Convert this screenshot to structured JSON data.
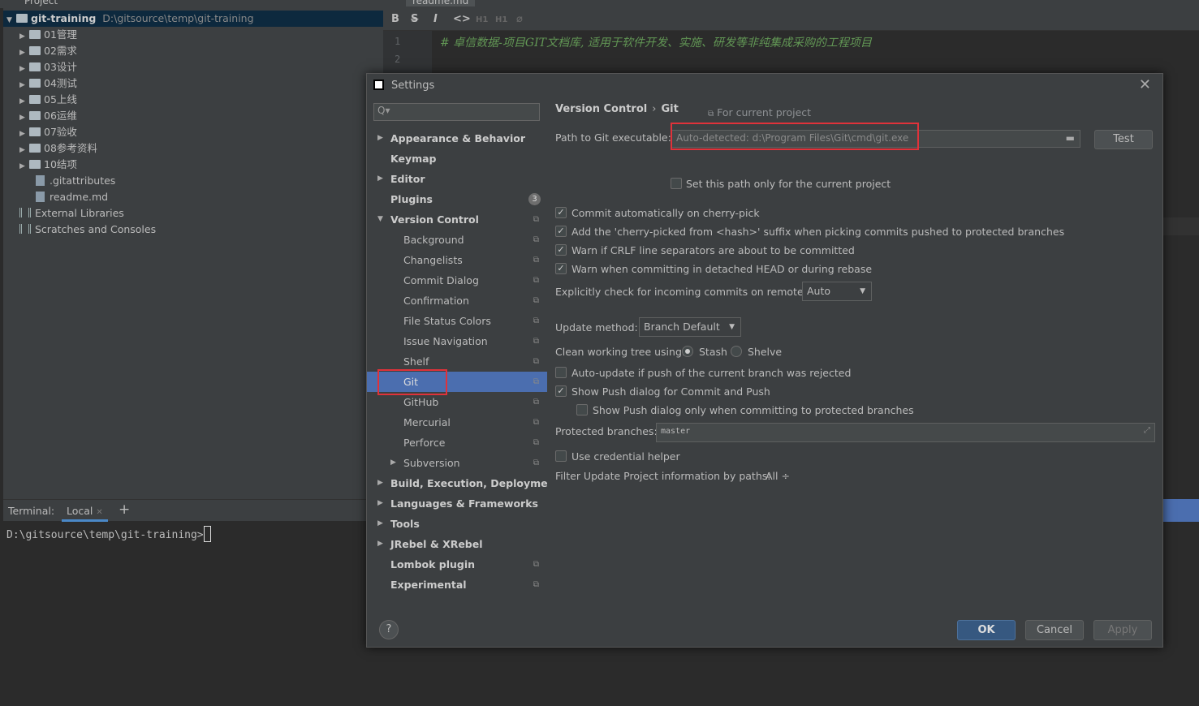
{
  "project": {
    "header": "Project",
    "root_name": "git-training",
    "root_path": "D:\\gitsource\\temp\\git-training",
    "folders": [
      "01管理",
      "02需求",
      "03设计",
      "04测试",
      "05上线",
      "06运维",
      "07验收",
      "08参考资料",
      "10结项"
    ],
    "files": [
      ".gitattributes",
      "readme.md"
    ],
    "external": "External Libraries",
    "scratches": "Scratches and Consoles"
  },
  "editor": {
    "tab": "readme.md",
    "toolbar": [
      "B",
      "S",
      "I",
      "<>",
      "H1",
      "H1",
      "⌀"
    ],
    "lines": [
      "1",
      "2"
    ],
    "line1": "# 卓信数据-项目GIT文档库, 适用于软件开发、实施、研发等非纯集成采购的工程项目"
  },
  "terminal": {
    "label": "Terminal:",
    "tab": "Local",
    "add": "+",
    "prompt": "D:\\gitsource\\temp\\git-training>"
  },
  "dialog": {
    "title": "Settings",
    "close": "✕",
    "search_placeholder": "Q▾",
    "nav": [
      {
        "label": "Appearance & Behavior",
        "bold": true,
        "arrow": "▶",
        "indent": 0
      },
      {
        "label": "Keymap",
        "bold": true,
        "arrow": "",
        "indent": 0
      },
      {
        "label": "Editor",
        "bold": true,
        "arrow": "▶",
        "indent": 0
      },
      {
        "label": "Plugins",
        "bold": true,
        "arrow": "",
        "indent": 0,
        "badge": "3"
      },
      {
        "label": "Version Control",
        "bold": true,
        "arrow": "▼",
        "indent": 0,
        "copy": true
      },
      {
        "label": "Background",
        "indent": 1,
        "copy": true
      },
      {
        "label": "Changelists",
        "indent": 1,
        "copy": true
      },
      {
        "label": "Commit Dialog",
        "indent": 1,
        "copy": true
      },
      {
        "label": "Confirmation",
        "indent": 1,
        "copy": true
      },
      {
        "label": "File Status Colors",
        "indent": 1,
        "copy": true
      },
      {
        "label": "Issue Navigation",
        "indent": 1,
        "copy": true
      },
      {
        "label": "Shelf",
        "indent": 1,
        "copy": true
      },
      {
        "label": "Git",
        "indent": 1,
        "copy": true,
        "selected": true
      },
      {
        "label": "GitHub",
        "indent": 1,
        "copy": true
      },
      {
        "label": "Mercurial",
        "indent": 1,
        "copy": true
      },
      {
        "label": "Perforce",
        "indent": 1,
        "copy": true
      },
      {
        "label": "Subversion",
        "indent": 1,
        "arrow": "▶",
        "copy": true
      },
      {
        "label": "Build, Execution, Deployment",
        "bold": true,
        "arrow": "▶",
        "indent": 0
      },
      {
        "label": "Languages & Frameworks",
        "bold": true,
        "arrow": "▶",
        "indent": 0
      },
      {
        "label": "Tools",
        "bold": true,
        "arrow": "▶",
        "indent": 0
      },
      {
        "label": "JRebel & XRebel",
        "bold": true,
        "arrow": "▶",
        "indent": 0
      },
      {
        "label": "Lombok plugin",
        "bold": true,
        "indent": 0,
        "copy": true
      },
      {
        "label": "Experimental",
        "bold": true,
        "indent": 0,
        "copy": true
      }
    ],
    "breadcrumb": [
      "Version Control",
      "Git"
    ],
    "breadcrumb_sep": "›",
    "for_project": "For current project",
    "path_label": "Path to Git executable:",
    "path_placeholder": "Auto-detected: d:\\Program Files\\Git\\cmd\\git.exe",
    "test_button": "Test",
    "set_path_only": "Set this path only for the current project",
    "checks": [
      {
        "label": "Commit automatically on cherry-pick",
        "checked": true
      },
      {
        "label": "Add the 'cherry-picked from <hash>' suffix when picking commits pushed to protected branches",
        "checked": true
      },
      {
        "label": "Warn if CRLF line separators are about to be committed",
        "checked": true
      },
      {
        "label": "Warn when committing in detached HEAD or during rebase",
        "checked": true
      }
    ],
    "incoming_label": "Explicitly check for incoming commits on remotes:",
    "incoming_value": "Auto",
    "update_label": "Update method:",
    "update_value": "Branch Default",
    "clean_label": "Clean working tree using:",
    "clean_stash": "Stash",
    "clean_shelve": "Shelve",
    "auto_update": "Auto-update if push of the current branch was rejected",
    "show_push": "Show Push dialog for Commit and Push",
    "show_push_protected": "Show Push dialog only when committing to protected branches",
    "protected_label": "Protected branches:",
    "protected_value": "master",
    "credential": "Use credential helper",
    "filter_label": "Filter Update Project information by paths:",
    "filter_value": "All ÷",
    "help": "?",
    "ok": "OK",
    "cancel": "Cancel",
    "apply": "Apply"
  }
}
